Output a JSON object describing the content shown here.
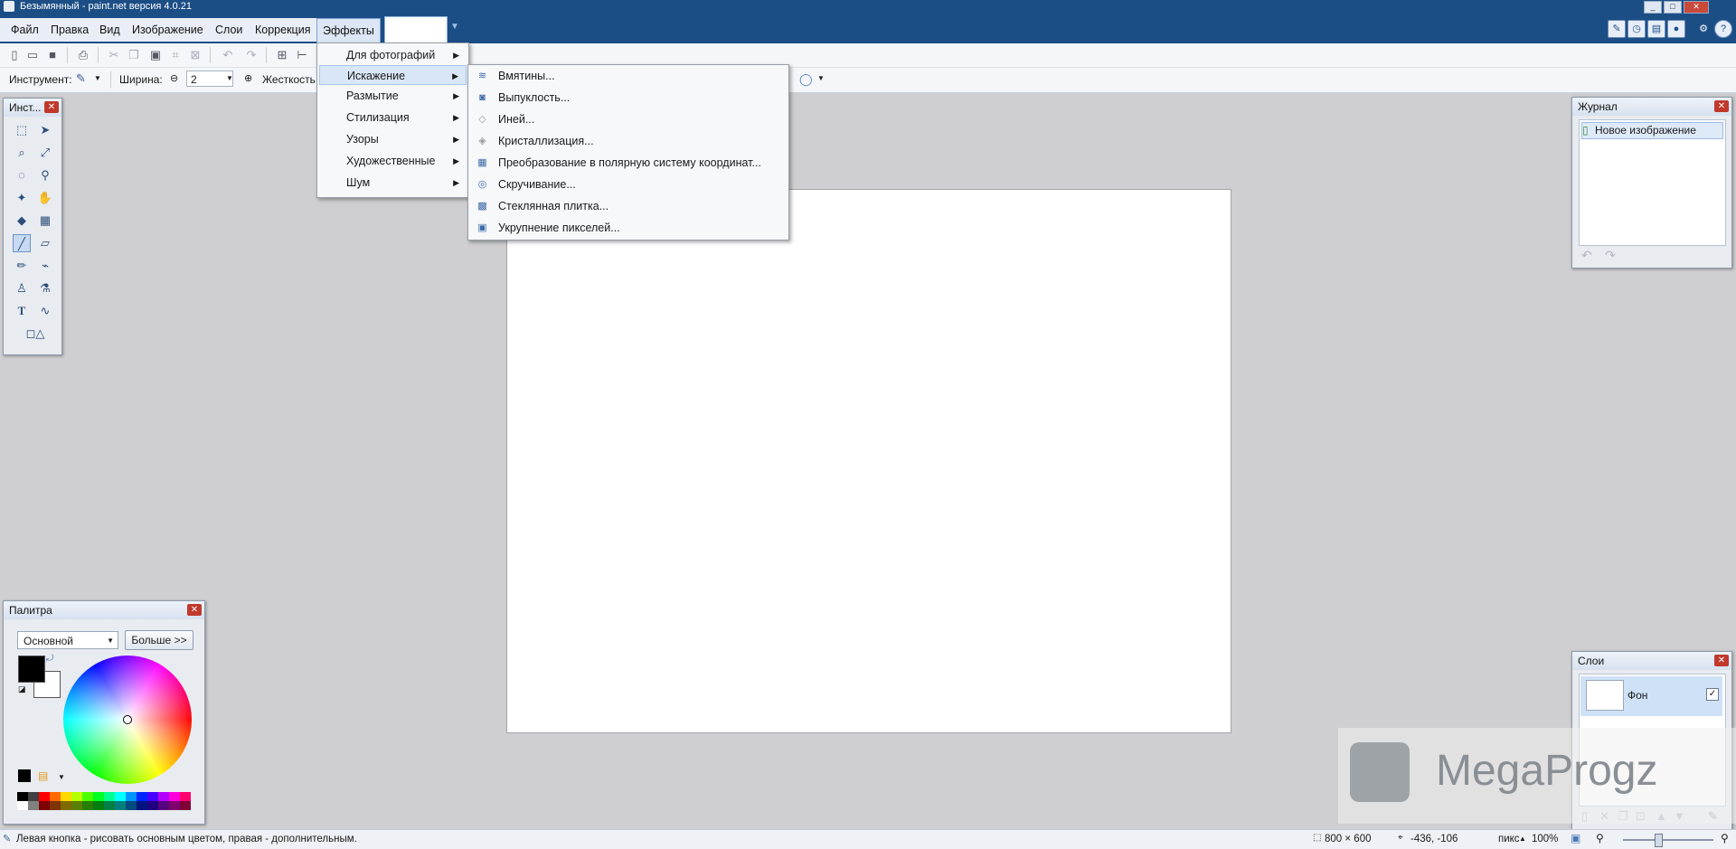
{
  "titlebar": {
    "title": "Безымянный - paint.net версия 4.0.21"
  },
  "menu": {
    "file": "Файл",
    "edit": "Правка",
    "view": "Вид",
    "image": "Изображение",
    "layers": "Слои",
    "adjustments": "Коррекция",
    "effects": "Эффекты"
  },
  "toolbar2": {
    "tool_label": "Инструмент:",
    "width_label": "Ширина:",
    "width_value": "2",
    "hardness_label": "Жесткость"
  },
  "effects_menu": {
    "items": [
      {
        "label": "Для фотографий"
      },
      {
        "label": "Искажение"
      },
      {
        "label": "Размытие"
      },
      {
        "label": "Стилизация"
      },
      {
        "label": "Узоры"
      },
      {
        "label": "Художественные"
      },
      {
        "label": "Шум"
      }
    ],
    "submenu_arrow": "▶"
  },
  "distort_menu": {
    "items": [
      {
        "label": "Вмятины...",
        "icon": "dents-icon"
      },
      {
        "label": "Выпуклость...",
        "icon": "bulge-icon"
      },
      {
        "label": "Иней...",
        "icon": "frost-icon"
      },
      {
        "label": "Кристаллизация...",
        "icon": "crystallize-icon"
      },
      {
        "label": "Преобразование в полярную систему координат...",
        "icon": "polar-inversion-icon"
      },
      {
        "label": "Скручивание...",
        "icon": "twist-icon"
      },
      {
        "label": "Стеклянная плитка...",
        "icon": "tile-reflection-icon"
      },
      {
        "label": "Укрупнение пикселей...",
        "icon": "pixelate-icon"
      }
    ]
  },
  "tools_panel": {
    "title": "Инст..."
  },
  "history_panel": {
    "title": "Журнал",
    "items": [
      "Новое изображение"
    ]
  },
  "layers_panel": {
    "title": "Слои",
    "layers": [
      {
        "name": "Фон",
        "visible": true
      }
    ]
  },
  "palette_panel": {
    "title": "Палитра",
    "mode": "Основной",
    "more_button": "Больше >>",
    "primary_color": "#000000",
    "secondary_color": "#ffffff"
  },
  "statusbar": {
    "hint": "Левая кнопка - рисовать основным цветом, правая - дополнительным.",
    "image_size": "800 × 600",
    "cursor_coords": "-436, -106",
    "unit": "пикс",
    "zoom": "100%"
  },
  "watermark": {
    "text": "MegaProgz"
  },
  "colors": {
    "titlebar": "#1c4e86",
    "workspace": "#cfcfd1",
    "menu_highlight": "#d8e6f7"
  }
}
